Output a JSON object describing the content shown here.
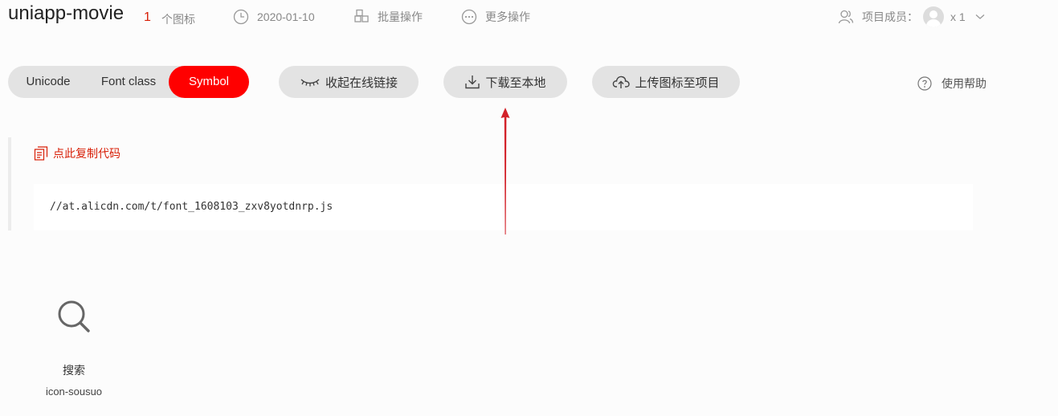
{
  "header": {
    "project_name": "uniapp-movie",
    "icon_count": "1",
    "icon_count_label": "个图标",
    "date": "2020-01-10",
    "batch_label": "批量操作",
    "more_label": "更多操作",
    "members_label": "项目成员：",
    "members_count": "x 1"
  },
  "toolbar": {
    "modes": [
      "Unicode",
      "Font class",
      "Symbol"
    ],
    "active_mode": "Symbol",
    "collapse_link_label": "收起在线链接",
    "download_label": "下载至本地",
    "upload_label": "上传图标至项目",
    "help_label": "使用帮助"
  },
  "code_panel": {
    "copy_label": "点此复制代码",
    "code": "//at.alicdn.com/t/font_1608103_zxv8yotdnrp.js"
  },
  "icons": [
    {
      "name": "搜索",
      "code": "icon-sousuo",
      "glyph": "search-icon"
    }
  ],
  "colors": {
    "accent": "#ff0000",
    "copy_text": "#d81e06",
    "annotation_arrow": "#d3222a",
    "pill_bg": "#e3e3e3"
  }
}
